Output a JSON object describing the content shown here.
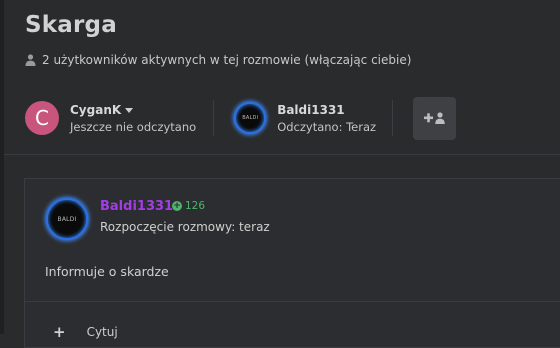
{
  "title": "Skarga",
  "participants_info": "2 użytkowników aktywnych w tej rozmowie (włączając ciebie)",
  "participants": [
    {
      "avatar_letter": "C",
      "name": "CyganK",
      "status": "Jeszcze nie odczytano",
      "avatar_color": "#c8557c"
    },
    {
      "avatar_label": "BALDI",
      "name": "Baldi1331",
      "status": "Odczytano: Teraz"
    }
  ],
  "message": {
    "avatar_label": "BALDI",
    "author": "Baldi1331",
    "points": "126",
    "started": "Rozpoczęcie rozmowy: teraz",
    "body": "Informuje o skardze",
    "quote_label": "Cytuj"
  },
  "colors": {
    "background": "#2a2b2d",
    "author": "#a23de5",
    "points": "#4fb36b",
    "avatar_ring": "#2b6fe0"
  }
}
